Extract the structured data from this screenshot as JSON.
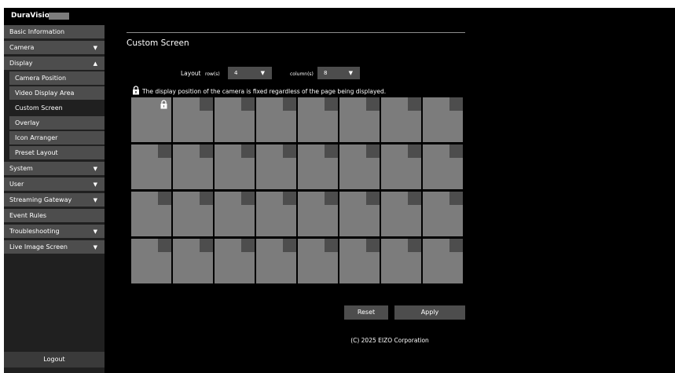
{
  "header": {
    "brand": "DuraVision"
  },
  "sidebar": {
    "items": [
      {
        "label": "Basic Information",
        "chevron": ""
      },
      {
        "label": "Camera",
        "chevron": "▼"
      },
      {
        "label": "Display",
        "chevron": "▲"
      },
      {
        "label": "System",
        "chevron": "▼"
      },
      {
        "label": "User",
        "chevron": "▼"
      },
      {
        "label": "Streaming Gateway",
        "chevron": "▼"
      },
      {
        "label": "Event Rules",
        "chevron": ""
      },
      {
        "label": "Troubleshooting",
        "chevron": "▼"
      },
      {
        "label": "Live Image Screen",
        "chevron": "▼"
      }
    ],
    "display_sub": [
      {
        "label": "Camera Position"
      },
      {
        "label": "Video Display Area"
      },
      {
        "label": "Custom Screen",
        "active": true
      },
      {
        "label": "Overlay"
      },
      {
        "label": "Icon Arranger"
      },
      {
        "label": "Preset Layout"
      }
    ],
    "logout": "Logout"
  },
  "main": {
    "title": "Custom Screen",
    "layout_label": "Layout",
    "rows_label": "row(s)",
    "rows_value": "4",
    "columns_label": "column(s)",
    "columns_value": "8",
    "dropdown_arrow": "▼",
    "notice": "The display position of the camera is fixed regardless of the page being displayed.",
    "grid": {
      "rows": 4,
      "columns": 8,
      "locked_cell": [
        0,
        0
      ]
    },
    "reset_label": "Reset",
    "apply_label": "Apply",
    "copyright": "(C) 2025 EIZO Corporation"
  },
  "icons": {
    "lock": "lock-icon",
    "chevron_down": "chevron-down-icon",
    "chevron_up": "chevron-up-icon"
  },
  "colors": {
    "background": "#000000",
    "sidebar": "#202020",
    "item": "#4d4d4d",
    "cell": "#7c7c7c"
  }
}
